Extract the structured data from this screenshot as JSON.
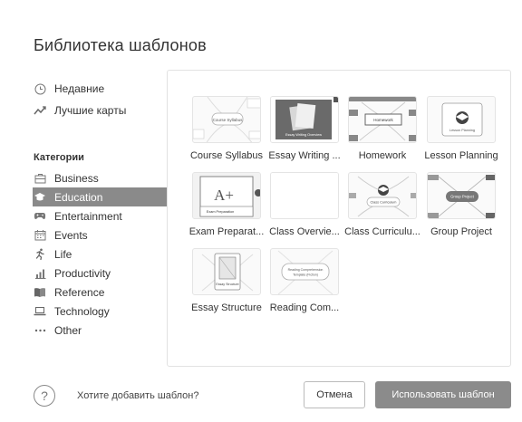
{
  "dialog": {
    "title": "Библиотека шаблонов"
  },
  "sidebar": {
    "top_items": [
      {
        "label": "Недавние",
        "icon": "clock-icon"
      },
      {
        "label": "Лучшие карты",
        "icon": "trend-icon"
      }
    ],
    "categories_heading": "Категории",
    "categories": [
      {
        "label": "Business",
        "icon": "briefcase-icon"
      },
      {
        "label": "Education",
        "icon": "graduation-cap-icon",
        "active": true
      },
      {
        "label": "Entertainment",
        "icon": "gamepad-icon"
      },
      {
        "label": "Events",
        "icon": "calendar-icon"
      },
      {
        "label": "Life",
        "icon": "running-person-icon"
      },
      {
        "label": "Productivity",
        "icon": "bar-chart-icon"
      },
      {
        "label": "Reference",
        "icon": "book-icon"
      },
      {
        "label": "Technology",
        "icon": "laptop-icon"
      },
      {
        "label": "Other",
        "icon": "ellipsis-icon"
      }
    ]
  },
  "templates": [
    {
      "label": "Course Syllabus",
      "thumb_text": "Course Syllabus"
    },
    {
      "label": "Essay Writing ...",
      "thumb_text": "Essay Writing Overview"
    },
    {
      "label": "Homework",
      "thumb_text": "Homework"
    },
    {
      "label": "Lesson Planning",
      "thumb_text": "Lesson Planning"
    },
    {
      "label": "Exam Preparat...",
      "thumb_text": "Exam Preparation",
      "big_text": "A+"
    },
    {
      "label": "Class Overvie...",
      "thumb_text": ""
    },
    {
      "label": "Class Curriculu...",
      "thumb_text": "Class Curriculum"
    },
    {
      "label": "Group Project",
      "thumb_text": "Group Project"
    },
    {
      "label": "Essay Structure",
      "thumb_text": "Essay Structure"
    },
    {
      "label": "Reading Com...",
      "thumb_text": "Reading Comprehension Template (Fiction)"
    }
  ],
  "footer": {
    "help_glyph": "?",
    "add_template_text": "Хотите добавить шаблон?",
    "cancel_label": "Отмена",
    "use_label": "Использовать шаблон"
  },
  "colors": {
    "active_bg": "#8a8a8a",
    "primary_button": "#8b8b8b"
  }
}
